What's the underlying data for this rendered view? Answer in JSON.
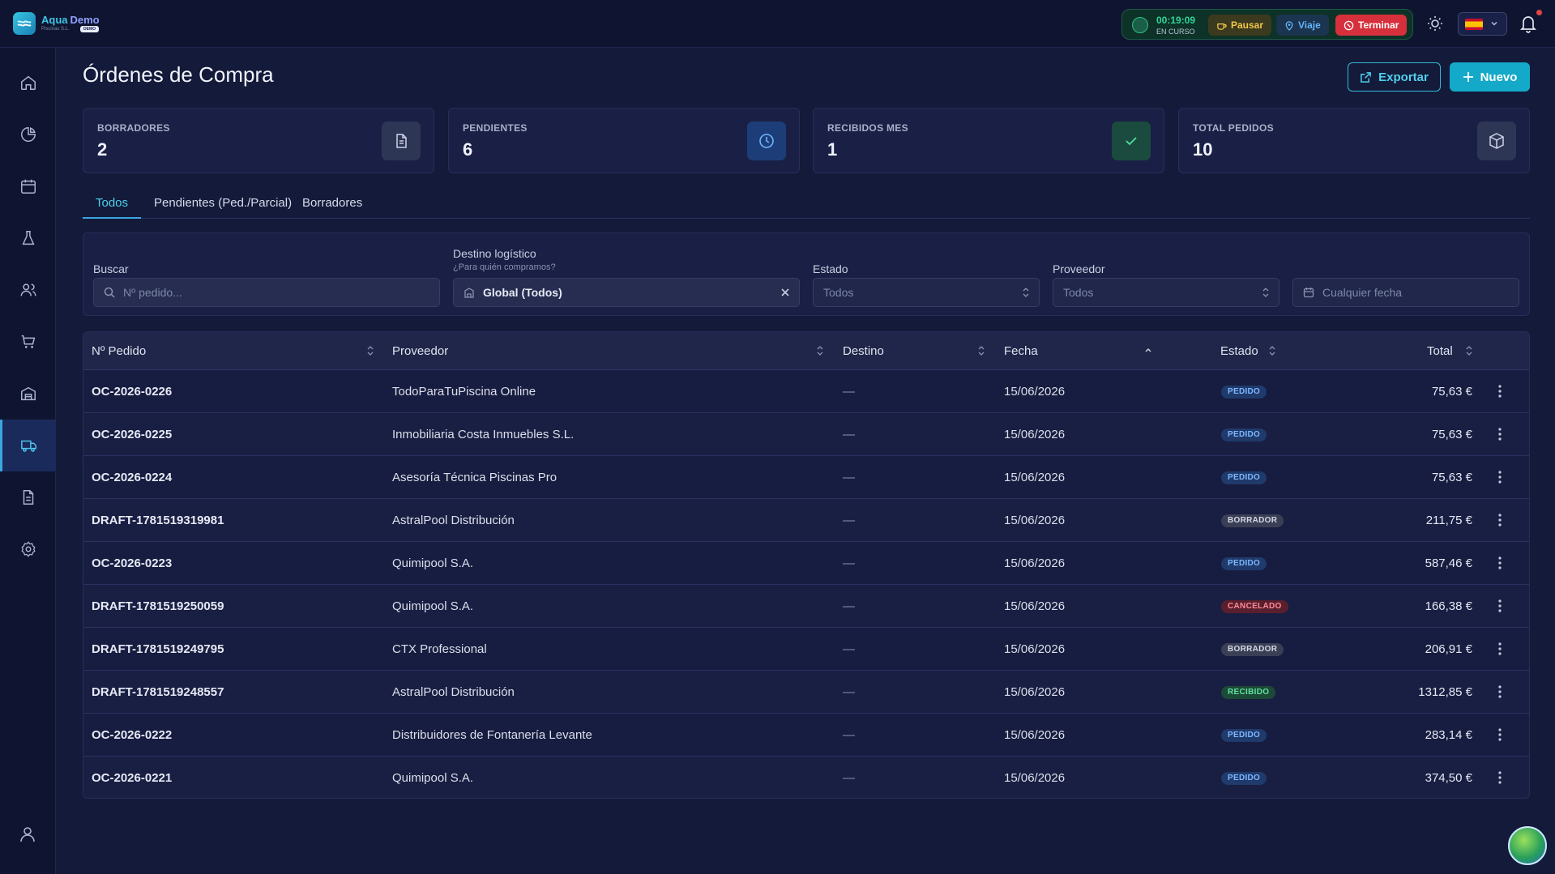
{
  "brand": {
    "name1": "Aqua",
    "name2": "Demo",
    "sub": "Piscinas S.L.",
    "badge": "DEMO"
  },
  "timer": {
    "time": "00:19:09",
    "status": "EN CURSO",
    "pause": "Pausar",
    "trip": "Viaje",
    "end": "Terminar"
  },
  "page": {
    "title": "Órdenes de Compra",
    "export": "Exportar",
    "new": "Nuevo"
  },
  "stats": [
    {
      "label": "BORRADORES",
      "value": "2",
      "icon": "document-icon"
    },
    {
      "label": "PENDIENTES",
      "value": "6",
      "icon": "clock-icon"
    },
    {
      "label": "RECIBIDOS MES",
      "value": "1",
      "icon": "check-icon"
    },
    {
      "label": "TOTAL PEDIDOS",
      "value": "10",
      "icon": "box-icon"
    }
  ],
  "tabs": [
    "Todos",
    "Pendientes (Ped./Parcial)",
    "Borradores"
  ],
  "filters": {
    "search_label": "Buscar",
    "search_placeholder": "Nº pedido...",
    "dest_label": "Destino logístico",
    "dest_sub": "¿Para quién compramos?",
    "dest_value": "Global (Todos)",
    "state_label": "Estado",
    "state_value": "Todos",
    "provider_label": "Proveedor",
    "provider_value": "Todos",
    "date_placeholder": "Cualquier fecha"
  },
  "table": {
    "headers": [
      "Nº Pedido",
      "Proveedor",
      "Destino",
      "Fecha",
      "Estado",
      "Total"
    ],
    "rows": [
      {
        "id": "OC-2026-0226",
        "prov": "TodoParaTuPiscina Online",
        "dest": "—",
        "date": "15/06/2026",
        "state": "PEDIDO",
        "total": "75,63 €"
      },
      {
        "id": "OC-2026-0225",
        "prov": "Inmobiliaria Costa Inmuebles S.L.",
        "dest": "—",
        "date": "15/06/2026",
        "state": "PEDIDO",
        "total": "75,63 €"
      },
      {
        "id": "OC-2026-0224",
        "prov": "Asesoría Técnica Piscinas Pro",
        "dest": "—",
        "date": "15/06/2026",
        "state": "PEDIDO",
        "total": "75,63 €"
      },
      {
        "id": "DRAFT-1781519319981",
        "prov": "AstralPool Distribución",
        "dest": "—",
        "date": "15/06/2026",
        "state": "BORRADOR",
        "total": "211,75 €"
      },
      {
        "id": "OC-2026-0223",
        "prov": "Quimipool S.A.",
        "dest": "—",
        "date": "15/06/2026",
        "state": "PEDIDO",
        "total": "587,46 €"
      },
      {
        "id": "DRAFT-1781519250059",
        "prov": "Quimipool S.A.",
        "dest": "—",
        "date": "15/06/2026",
        "state": "CANCELADO",
        "total": "166,38 €"
      },
      {
        "id": "DRAFT-1781519249795",
        "prov": "CTX Professional",
        "dest": "—",
        "date": "15/06/2026",
        "state": "BORRADOR",
        "total": "206,91 €"
      },
      {
        "id": "DRAFT-1781519248557",
        "prov": "AstralPool Distribución",
        "dest": "—",
        "date": "15/06/2026",
        "state": "RECIBIDO",
        "total": "1312,85 €"
      },
      {
        "id": "OC-2026-0222",
        "prov": "Distribuidores de Fontanería Levante",
        "dest": "—",
        "date": "15/06/2026",
        "state": "PEDIDO",
        "total": "283,14 €"
      },
      {
        "id": "OC-2026-0221",
        "prov": "Quimipool S.A.",
        "dest": "—",
        "date": "15/06/2026",
        "state": "PEDIDO",
        "total": "374,50 €"
      }
    ]
  }
}
